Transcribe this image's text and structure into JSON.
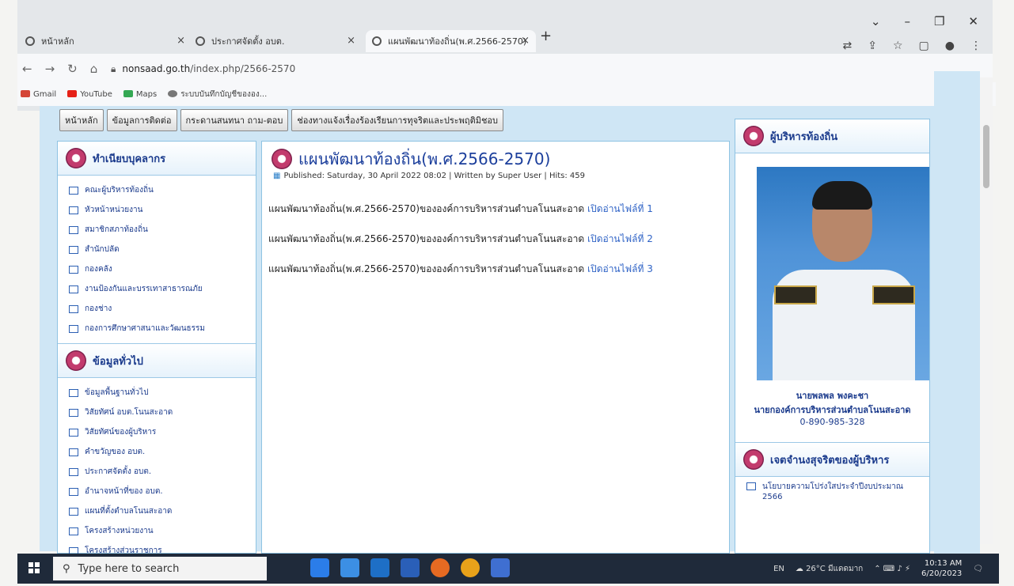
{
  "browser": {
    "tabs": [
      {
        "label": "หน้าหลัก"
      },
      {
        "label": "ประกาศจัดตั้ง อบต."
      },
      {
        "label": "แผนพัฒนาท้องถิ่น(พ.ศ.2566-2570)"
      }
    ],
    "url_domain": "nonsaad.go.th",
    "url_path": "/index.php/2566-2570",
    "bookmarks": [
      "Gmail",
      "YouTube",
      "Maps",
      "ระบบบันทึกบัญชีขององ..."
    ]
  },
  "menu": [
    "หน้าหลัก",
    "ข้อมูลการติดต่อ",
    "กระดานสนทนา ถาม-ตอบ",
    "ช่องทางแจ้งเรื่องร้องเรียนการทุจริตและประพฤติมิชอบ"
  ],
  "left": {
    "section1": {
      "title": "ทำเนียบบุคลากร",
      "items": [
        "คณะผู้บริหารท้องถิ่น",
        "หัวหน้าหน่วยงาน",
        "สมาชิกสภาท้องถิ่น",
        "สำนักปลัด",
        "กองคลัง",
        "งานป้องกันและบรรเทาสาธารณภัย",
        "กองช่าง",
        "กองการศึกษาศาสนาและวัฒนธรรม"
      ]
    },
    "section2": {
      "title": "ข้อมูลทั่วไป",
      "items": [
        "ข้อมูลพื้นฐานทั่วไป",
        "วิสัยทัศน์ อบต.โนนสะอาด",
        "วิสัยทัศน์ของผู้บริหาร",
        "คำขวัญของ อบต.",
        "ประกาศจัดตั้ง อบต.",
        "อำนาจหน้าที่ของ อบต.",
        "แผนที่ตั้งตำบลโนนสะอาด",
        "โครงสร้างหน่วยงาน",
        "โครงสร้างส่วนราชการ"
      ]
    }
  },
  "article": {
    "title": "แผนพัฒนาท้องถิ่น(พ.ศ.2566-2570)",
    "meta": "Published: Saturday, 30 April 2022 08:02 | Written by Super User | Hits: 459",
    "lines": [
      {
        "text": "แผนพัฒนาท้องถิ่น(พ.ศ.2566-2570)ขององค์การบริหารส่วนตำบลโนนสะอาด",
        "link": "เปิดอ่านไฟล์ที่ 1"
      },
      {
        "text": "แผนพัฒนาท้องถิ่น(พ.ศ.2566-2570)ขององค์การบริหารส่วนตำบลโนนสะอาด",
        "link": "เปิดอ่านไฟล์ที่ 2"
      },
      {
        "text": "แผนพัฒนาท้องถิ่น(พ.ศ.2566-2570)ขององค์การบริหารส่วนตำบลโนนสะอาด",
        "link": "เปิดอ่านไฟล์ที่ 3"
      }
    ]
  },
  "right": {
    "title": "ผู้บริหารท้องถิ่น",
    "name": "นายพลพล พงคะชา",
    "position": "นายกองค์การบริหารส่วนตำบลโนนสะอาด",
    "phone": "0-890-985-328",
    "title2": "เจตจำนงสุจริตของผู้บริหาร",
    "items2": [
      "นโยบายความโปร่งใสประจำปีงบประมาณ 2566"
    ]
  },
  "taskbar": {
    "search_placeholder": "Type here to search",
    "lang": "EN",
    "weather": "26°C มีแดดมาก",
    "time": "10:13 AM",
    "date": "6/20/2023"
  },
  "colors": {
    "link": "#2f63c6",
    "heading": "#1c3f9c",
    "page_bg": "#cfe6f5"
  }
}
